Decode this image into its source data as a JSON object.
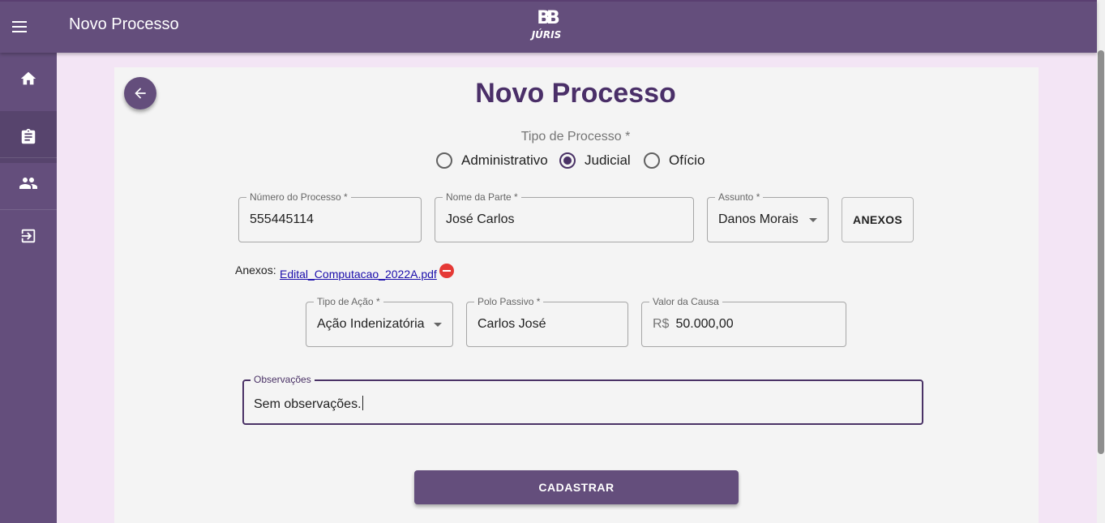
{
  "appbar": {
    "title": "Novo Processo",
    "logo_top": "BB",
    "logo_bottom": "JÚRIS"
  },
  "sidebar": {
    "items": [
      {
        "icon": "home-icon"
      },
      {
        "icon": "clipboard-icon",
        "active": true
      },
      {
        "icon": "people-icon"
      },
      {
        "icon": "logout-icon"
      }
    ]
  },
  "form": {
    "title": "Novo Processo",
    "tipo_label": "Tipo de Processo *",
    "tipos": [
      {
        "label": "Administrativo",
        "checked": false
      },
      {
        "label": "Judicial",
        "checked": true
      },
      {
        "label": "Ofício",
        "checked": false
      }
    ],
    "numero": {
      "label": "Número do Processo *",
      "value": "555445114"
    },
    "nome_parte": {
      "label": "Nome da Parte *",
      "value": "José Carlos"
    },
    "assunto": {
      "label": "Assunto *",
      "value": "Danos Morais"
    },
    "anexos_button": "ANEXOS",
    "anexos_label": "Anexos:",
    "anexo_file": "Edital_Computacao_2022A.pdf",
    "tipo_acao": {
      "label": "Tipo de Ação *",
      "value": "Ação Indenizatória"
    },
    "polo_passivo": {
      "label": "Polo Passivo *",
      "value": "Carlos José"
    },
    "valor_causa": {
      "label": "Valor da Causa",
      "prefix": "R$",
      "value": "50.000,00"
    },
    "observacoes": {
      "label": "Observações",
      "value": "Sem observações."
    },
    "submit": "CADASTRAR"
  },
  "colors": {
    "primary": "#644e7c",
    "title": "#4a2f68",
    "background": "#f3e5f5",
    "remove": "#e53935"
  }
}
